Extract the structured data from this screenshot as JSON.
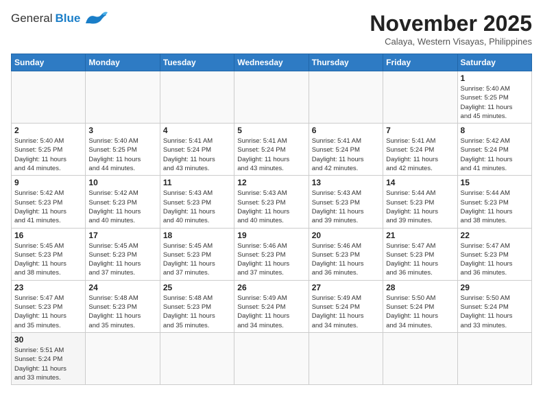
{
  "header": {
    "logo_general": "General",
    "logo_blue": "Blue",
    "month_title": "November 2025",
    "location": "Calaya, Western Visayas, Philippines"
  },
  "weekdays": [
    "Sunday",
    "Monday",
    "Tuesday",
    "Wednesday",
    "Thursday",
    "Friday",
    "Saturday"
  ],
  "weeks": [
    [
      {
        "day": "",
        "info": ""
      },
      {
        "day": "",
        "info": ""
      },
      {
        "day": "",
        "info": ""
      },
      {
        "day": "",
        "info": ""
      },
      {
        "day": "",
        "info": ""
      },
      {
        "day": "",
        "info": ""
      },
      {
        "day": "1",
        "info": "Sunrise: 5:40 AM\nSunset: 5:25 PM\nDaylight: 11 hours\nand 45 minutes."
      }
    ],
    [
      {
        "day": "2",
        "info": "Sunrise: 5:40 AM\nSunset: 5:25 PM\nDaylight: 11 hours\nand 44 minutes."
      },
      {
        "day": "3",
        "info": "Sunrise: 5:40 AM\nSunset: 5:25 PM\nDaylight: 11 hours\nand 44 minutes."
      },
      {
        "day": "4",
        "info": "Sunrise: 5:41 AM\nSunset: 5:24 PM\nDaylight: 11 hours\nand 43 minutes."
      },
      {
        "day": "5",
        "info": "Sunrise: 5:41 AM\nSunset: 5:24 PM\nDaylight: 11 hours\nand 43 minutes."
      },
      {
        "day": "6",
        "info": "Sunrise: 5:41 AM\nSunset: 5:24 PM\nDaylight: 11 hours\nand 42 minutes."
      },
      {
        "day": "7",
        "info": "Sunrise: 5:41 AM\nSunset: 5:24 PM\nDaylight: 11 hours\nand 42 minutes."
      },
      {
        "day": "8",
        "info": "Sunrise: 5:42 AM\nSunset: 5:24 PM\nDaylight: 11 hours\nand 41 minutes."
      }
    ],
    [
      {
        "day": "9",
        "info": "Sunrise: 5:42 AM\nSunset: 5:23 PM\nDaylight: 11 hours\nand 41 minutes."
      },
      {
        "day": "10",
        "info": "Sunrise: 5:42 AM\nSunset: 5:23 PM\nDaylight: 11 hours\nand 40 minutes."
      },
      {
        "day": "11",
        "info": "Sunrise: 5:43 AM\nSunset: 5:23 PM\nDaylight: 11 hours\nand 40 minutes."
      },
      {
        "day": "12",
        "info": "Sunrise: 5:43 AM\nSunset: 5:23 PM\nDaylight: 11 hours\nand 40 minutes."
      },
      {
        "day": "13",
        "info": "Sunrise: 5:43 AM\nSunset: 5:23 PM\nDaylight: 11 hours\nand 39 minutes."
      },
      {
        "day": "14",
        "info": "Sunrise: 5:44 AM\nSunset: 5:23 PM\nDaylight: 11 hours\nand 39 minutes."
      },
      {
        "day": "15",
        "info": "Sunrise: 5:44 AM\nSunset: 5:23 PM\nDaylight: 11 hours\nand 38 minutes."
      }
    ],
    [
      {
        "day": "16",
        "info": "Sunrise: 5:45 AM\nSunset: 5:23 PM\nDaylight: 11 hours\nand 38 minutes."
      },
      {
        "day": "17",
        "info": "Sunrise: 5:45 AM\nSunset: 5:23 PM\nDaylight: 11 hours\nand 37 minutes."
      },
      {
        "day": "18",
        "info": "Sunrise: 5:45 AM\nSunset: 5:23 PM\nDaylight: 11 hours\nand 37 minutes."
      },
      {
        "day": "19",
        "info": "Sunrise: 5:46 AM\nSunset: 5:23 PM\nDaylight: 11 hours\nand 37 minutes."
      },
      {
        "day": "20",
        "info": "Sunrise: 5:46 AM\nSunset: 5:23 PM\nDaylight: 11 hours\nand 36 minutes."
      },
      {
        "day": "21",
        "info": "Sunrise: 5:47 AM\nSunset: 5:23 PM\nDaylight: 11 hours\nand 36 minutes."
      },
      {
        "day": "22",
        "info": "Sunrise: 5:47 AM\nSunset: 5:23 PM\nDaylight: 11 hours\nand 36 minutes."
      }
    ],
    [
      {
        "day": "23",
        "info": "Sunrise: 5:47 AM\nSunset: 5:23 PM\nDaylight: 11 hours\nand 35 minutes."
      },
      {
        "day": "24",
        "info": "Sunrise: 5:48 AM\nSunset: 5:23 PM\nDaylight: 11 hours\nand 35 minutes."
      },
      {
        "day": "25",
        "info": "Sunrise: 5:48 AM\nSunset: 5:23 PM\nDaylight: 11 hours\nand 35 minutes."
      },
      {
        "day": "26",
        "info": "Sunrise: 5:49 AM\nSunset: 5:24 PM\nDaylight: 11 hours\nand 34 minutes."
      },
      {
        "day": "27",
        "info": "Sunrise: 5:49 AM\nSunset: 5:24 PM\nDaylight: 11 hours\nand 34 minutes."
      },
      {
        "day": "28",
        "info": "Sunrise: 5:50 AM\nSunset: 5:24 PM\nDaylight: 11 hours\nand 34 minutes."
      },
      {
        "day": "29",
        "info": "Sunrise: 5:50 AM\nSunset: 5:24 PM\nDaylight: 11 hours\nand 33 minutes."
      }
    ],
    [
      {
        "day": "30",
        "info": "Sunrise: 5:51 AM\nSunset: 5:24 PM\nDaylight: 11 hours\nand 33 minutes."
      },
      {
        "day": "",
        "info": ""
      },
      {
        "day": "",
        "info": ""
      },
      {
        "day": "",
        "info": ""
      },
      {
        "day": "",
        "info": ""
      },
      {
        "day": "",
        "info": ""
      },
      {
        "day": "",
        "info": ""
      }
    ]
  ]
}
